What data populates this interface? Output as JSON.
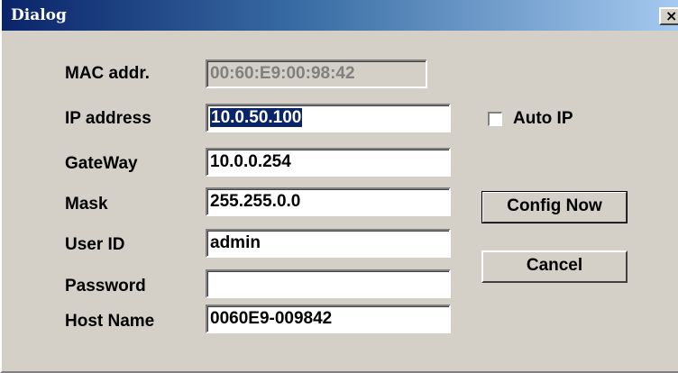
{
  "window": {
    "title": "Dialog",
    "close_glyph": "×"
  },
  "form": {
    "mac": {
      "label": "MAC addr.",
      "value": "00:60:E9:00:98:42"
    },
    "ip": {
      "label": "IP address",
      "value": "10.0.50.100"
    },
    "gateway": {
      "label": "GateWay",
      "value": "10.0.0.254"
    },
    "mask": {
      "label": "Mask",
      "value": "255.255.0.0"
    },
    "user": {
      "label": "User ID",
      "value": "admin"
    },
    "password": {
      "label": "Password",
      "value": ""
    },
    "host": {
      "label": "Host Name",
      "value": "0060E9-009842"
    }
  },
  "options": {
    "auto_ip_label": "Auto IP",
    "auto_ip_checked": false
  },
  "buttons": {
    "config_now": "Config Now",
    "cancel": "Cancel"
  },
  "colors": {
    "dialog_bg": "#d4d0c8",
    "title_start": "#0a246a",
    "title_end": "#a6caf0",
    "selection": "#0a246a"
  }
}
